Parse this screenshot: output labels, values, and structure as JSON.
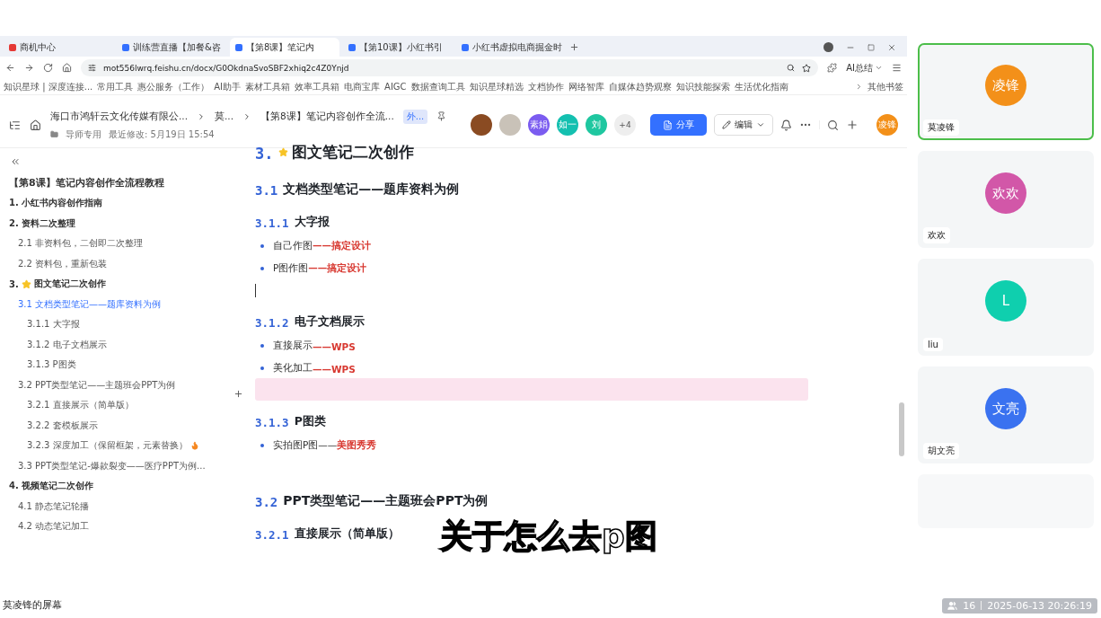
{
  "browser": {
    "tabs": [
      {
        "label": "商机中心",
        "selected": false,
        "color": "#e53935"
      },
      {
        "label": "训练营直播【加餐&咨",
        "selected": false,
        "color": "#3370ff"
      },
      {
        "label": "【第8课】笔记内",
        "selected": true,
        "color": "#3370ff"
      },
      {
        "label": "【第10课】小红书引",
        "selected": false,
        "color": "#3370ff"
      },
      {
        "label": "小红书虚拟电商掘金时",
        "selected": false,
        "color": "#3370ff"
      }
    ],
    "url": "mot556lwrq.feishu.cn/docx/G0OkdnaSvoSBF2xhiq2c4Z0Ynjd",
    "ai_button": "AI总结",
    "bookmarks": [
      "知识星球 | 深度连接...",
      "常用工具",
      "惠公服务（工作）",
      "AI助手",
      "素材工具箱",
      "效率工具箱",
      "电商宝库",
      "AIGC",
      "数据查询工具",
      "知识星球精选",
      "文档协作",
      "网络智库",
      "自媒体趋势观察",
      "知识技能探索",
      "生活优化指南"
    ],
    "other_bookmarks": "其他书签"
  },
  "doc_header": {
    "breadcrumb": [
      "海口市鸿轩云文化传媒有限公...",
      "莫...",
      "【第8课】笔记内容创作全流..."
    ],
    "badge": "外...",
    "folder": "导师专用",
    "modified": "最近修改: 5月19日 15:54",
    "collaborators": [
      {
        "kind": "photo",
        "color": "#8a4b22"
      },
      {
        "kind": "photo",
        "color": "#c9c2b8"
      },
      {
        "kind": "initials",
        "label": "素娟",
        "color": "#7b5cf0"
      },
      {
        "kind": "initials",
        "label": "如一",
        "color": "#14c0b0"
      },
      {
        "kind": "initials",
        "label": "刘",
        "color": "#1fc7a0"
      }
    ],
    "more_count": "+4",
    "share": "分享",
    "edit": "编辑",
    "user_avatar": "凌锋"
  },
  "outline": {
    "title": "【第8课】笔记内容创作全流程教程",
    "items": [
      {
        "label": "1. 小红书内容创作指南",
        "selected": false
      },
      {
        "label": "2. 资料二次整理",
        "selected": false,
        "children": [
          {
            "label": "2.1 非资料包，二创即二次整理",
            "selected": false
          },
          {
            "label": "2.2 资料包，重新包装",
            "selected": false
          }
        ]
      },
      {
        "label": "3. 图文笔记二次创作",
        "selected": false,
        "children": [
          {
            "label": "3.1 文档类型笔记——题库资料为例",
            "selected": true,
            "children": [
              {
                "label": "3.1.1 大字报",
                "selected": false
              },
              {
                "label": "3.1.2 电子文档展示",
                "selected": false
              },
              {
                "label": "3.1.3 P图类",
                "selected": false
              }
            ]
          },
          {
            "label": "3.2 PPT类型笔记——主题班会PPT为例",
            "selected": false,
            "children": [
              {
                "label": "3.2.1 直接展示（简单版）",
                "selected": false
              },
              {
                "label": "3.2.2 套模板展示",
                "selected": false
              },
              {
                "label": "3.2.3 深度加工（保留框架，元素替换）",
                "selected": false
              }
            ]
          },
          {
            "label": "3.3 PPT类型笔记-爆款裂变——医疗PPT为例...",
            "selected": false
          }
        ]
      },
      {
        "label": "4. 视频笔记二次创作",
        "selected": false,
        "children": [
          {
            "label": "4.1 静态笔记轮播",
            "selected": false
          },
          {
            "label": "4.2 动态笔记加工",
            "selected": false
          }
        ]
      }
    ]
  },
  "content": {
    "blocks": [
      {
        "kind": "h1",
        "number": "3.",
        "title": "图文笔记二次创作"
      },
      {
        "kind": "h2",
        "number": "3.1",
        "title": "文档类型笔记——题库资料为例"
      },
      {
        "kind": "h3",
        "number": "3.1.1",
        "title": "大字报"
      },
      {
        "kind": "bullet",
        "text": "自己作图",
        "accent": "——搞定设计"
      },
      {
        "kind": "bullet",
        "text": "P图作图",
        "accent": "——搞定设计"
      },
      {
        "kind": "empty",
        "cursor": true,
        "highlighted": false
      },
      {
        "kind": "h3",
        "number": "3.1.2",
        "title": "电子文档展示"
      },
      {
        "kind": "bullet",
        "text": "直接展示",
        "accent": "——WPS"
      },
      {
        "kind": "bullet",
        "text": "美化加工",
        "accent": "——WPS"
      },
      {
        "kind": "empty",
        "cursor": false,
        "highlighted": true
      },
      {
        "kind": "h3",
        "number": "3.1.3",
        "title": "P图类"
      },
      {
        "kind": "bullet",
        "text": "实拍图P图——",
        "accent": "美图秀秀"
      },
      {
        "kind": "empty",
        "cursor": false,
        "highlighted": false
      },
      {
        "kind": "h2",
        "number": "3.2",
        "title": "PPT类型笔记——主题班会PPT为例"
      },
      {
        "kind": "h3",
        "number": "3.2.1",
        "title": "直接展示（简单版）"
      }
    ]
  },
  "subtitle": "关于怎么去p图",
  "participants": [
    {
      "avatar": "凌锋",
      "name": "莫凌锋",
      "color": "#f39019",
      "speaking": true
    },
    {
      "avatar": "欢欢",
      "name": "欢欢",
      "color": "#d257a8",
      "speaking": false
    },
    {
      "avatar": "L",
      "name": "liu",
      "color": "#0fcfae",
      "speaking": false
    },
    {
      "avatar": "文亮",
      "name": "胡文亮",
      "color": "#3a72f0",
      "speaking": false
    }
  ],
  "footer": {
    "screen_label": "莫凌锋的屏幕",
    "participant_count": "16",
    "datetime": "2025-06-13 20:26:19"
  }
}
